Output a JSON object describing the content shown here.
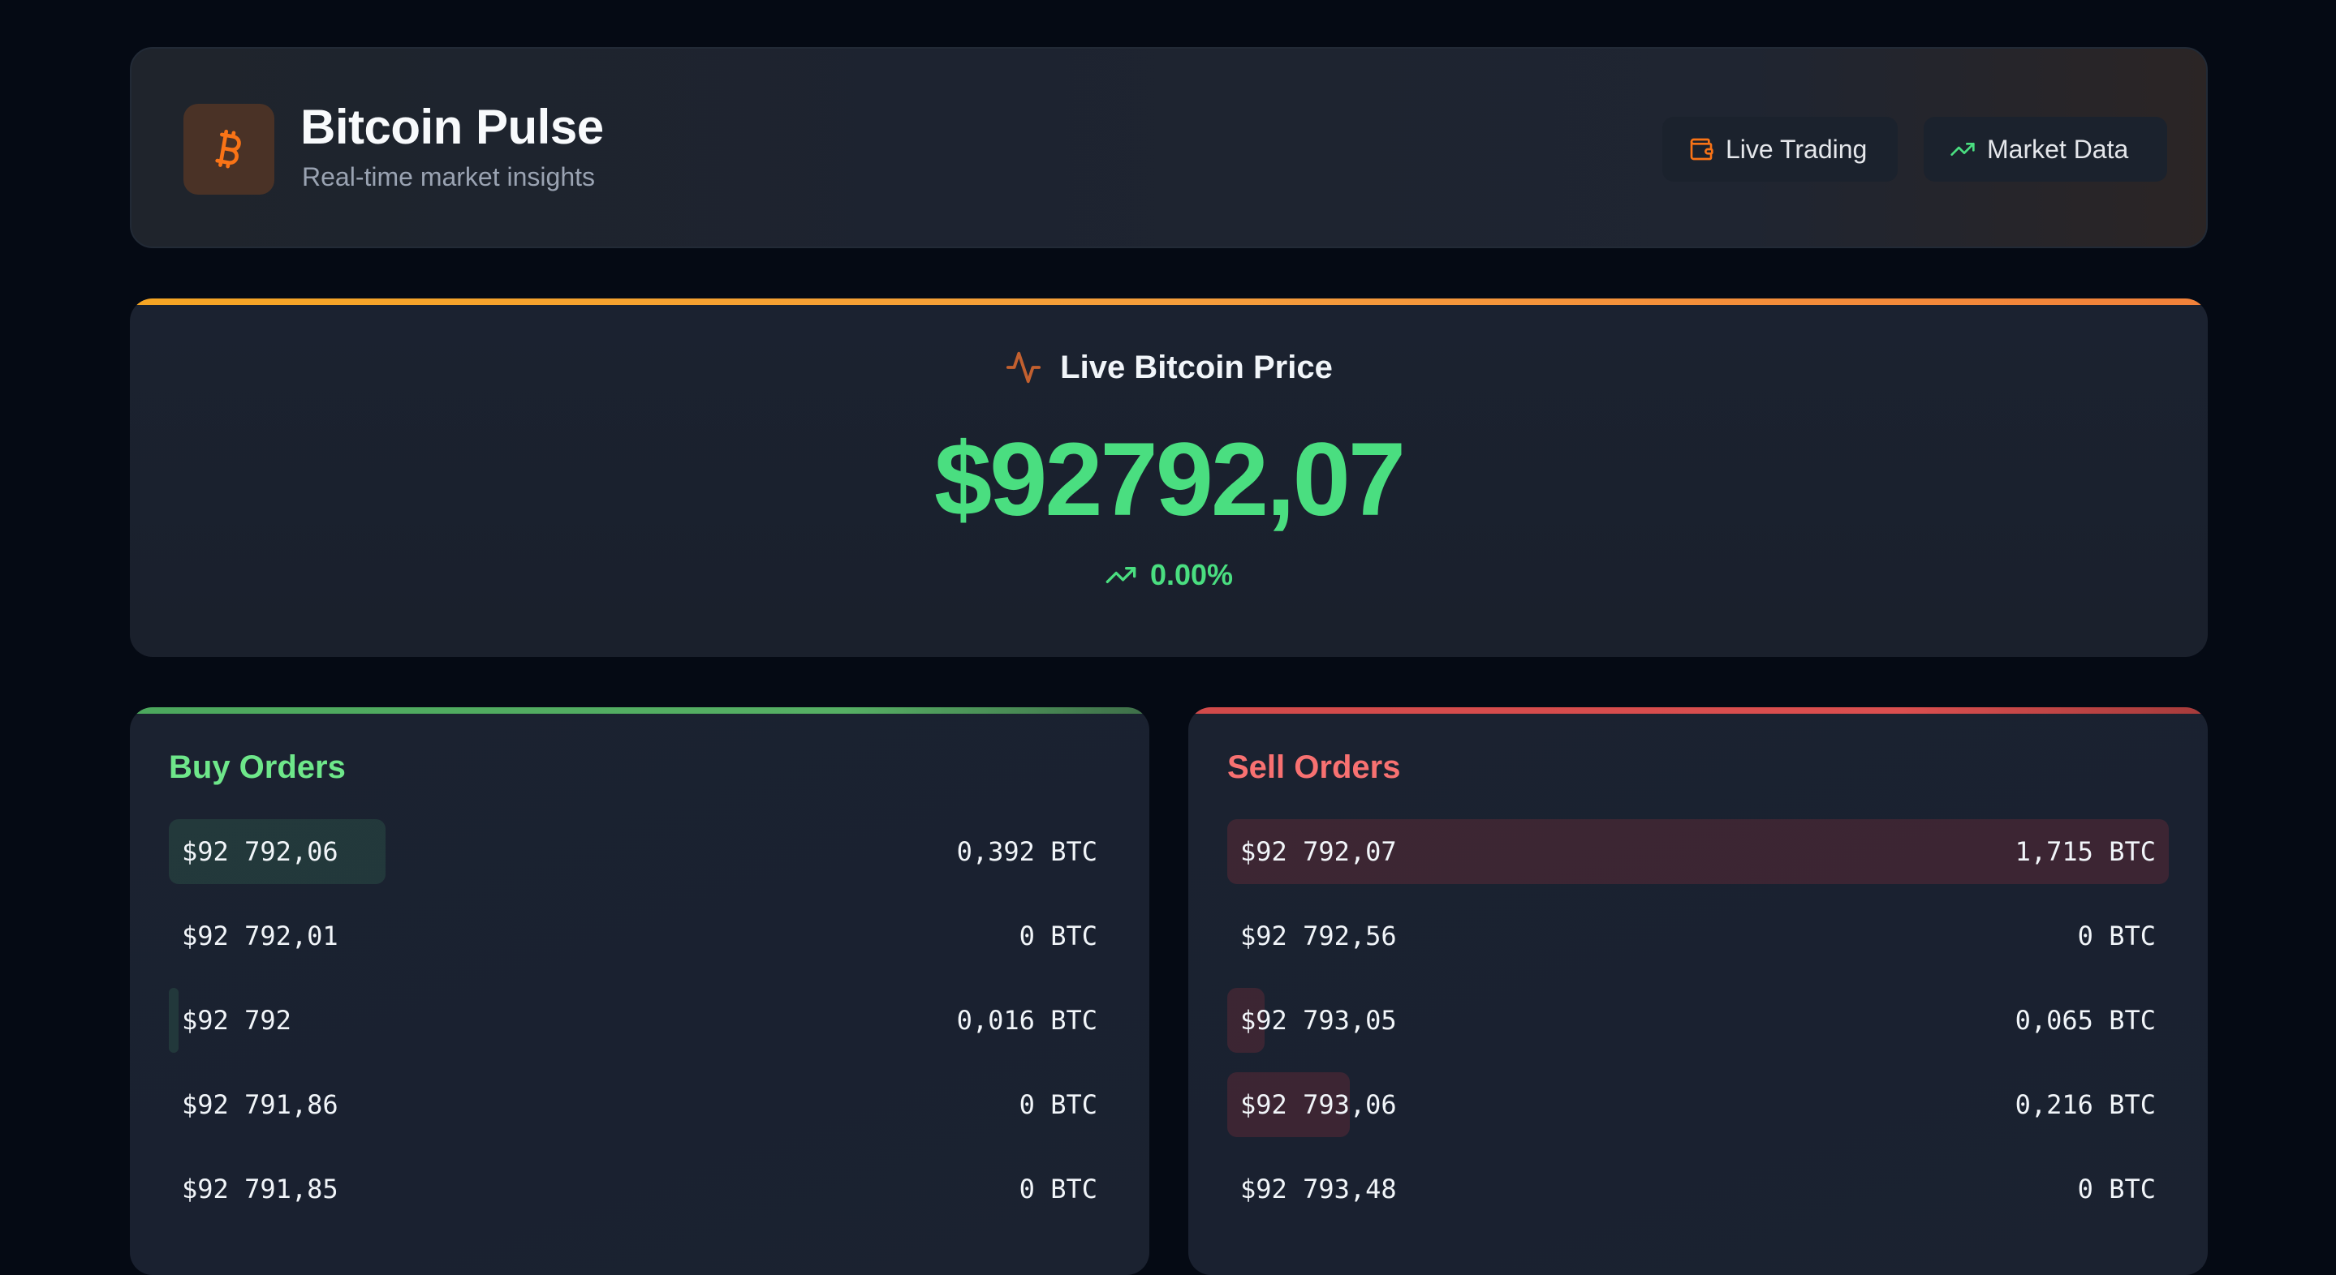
{
  "header": {
    "logo_icon": "bitcoin-icon",
    "title": "Bitcoin Pulse",
    "subtitle": "Real-time market insights",
    "buttons": [
      {
        "label": "Live Trading",
        "icon": "wallet-icon"
      },
      {
        "label": "Market Data",
        "icon": "trending-up-icon"
      }
    ]
  },
  "price_card": {
    "icon": "activity-icon",
    "label": "Live Bitcoin Price",
    "price": "$92792,07",
    "change_icon": "trending-up-icon",
    "change": "0.00%"
  },
  "buy_orders": {
    "title": "Buy Orders",
    "rows": [
      {
        "price": "$92 792,06",
        "amount": "0,392 BTC",
        "depth_pct": 23
      },
      {
        "price": "$92 792,01",
        "amount": "0 BTC",
        "depth_pct": 0
      },
      {
        "price": "$92 792",
        "amount": "0,016 BTC",
        "depth_pct": 1
      },
      {
        "price": "$92 791,86",
        "amount": "0 BTC",
        "depth_pct": 0
      },
      {
        "price": "$92 791,85",
        "amount": "0 BTC",
        "depth_pct": 0
      }
    ]
  },
  "sell_orders": {
    "title": "Sell Orders",
    "rows": [
      {
        "price": "$92 792,07",
        "amount": "1,715 BTC",
        "depth_pct": 100
      },
      {
        "price": "$92 792,56",
        "amount": "0 BTC",
        "depth_pct": 0
      },
      {
        "price": "$92 793,05",
        "amount": "0,065 BTC",
        "depth_pct": 4
      },
      {
        "price": "$92 793,06",
        "amount": "0,216 BTC",
        "depth_pct": 13
      },
      {
        "price": "$92 793,48",
        "amount": "0 BTC",
        "depth_pct": 0
      }
    ]
  },
  "colors": {
    "background": "#050a14",
    "card": "#1b2230",
    "accent_orange": "#f59e3b",
    "buy_green": "#4ade80",
    "sell_red": "#f87171"
  }
}
